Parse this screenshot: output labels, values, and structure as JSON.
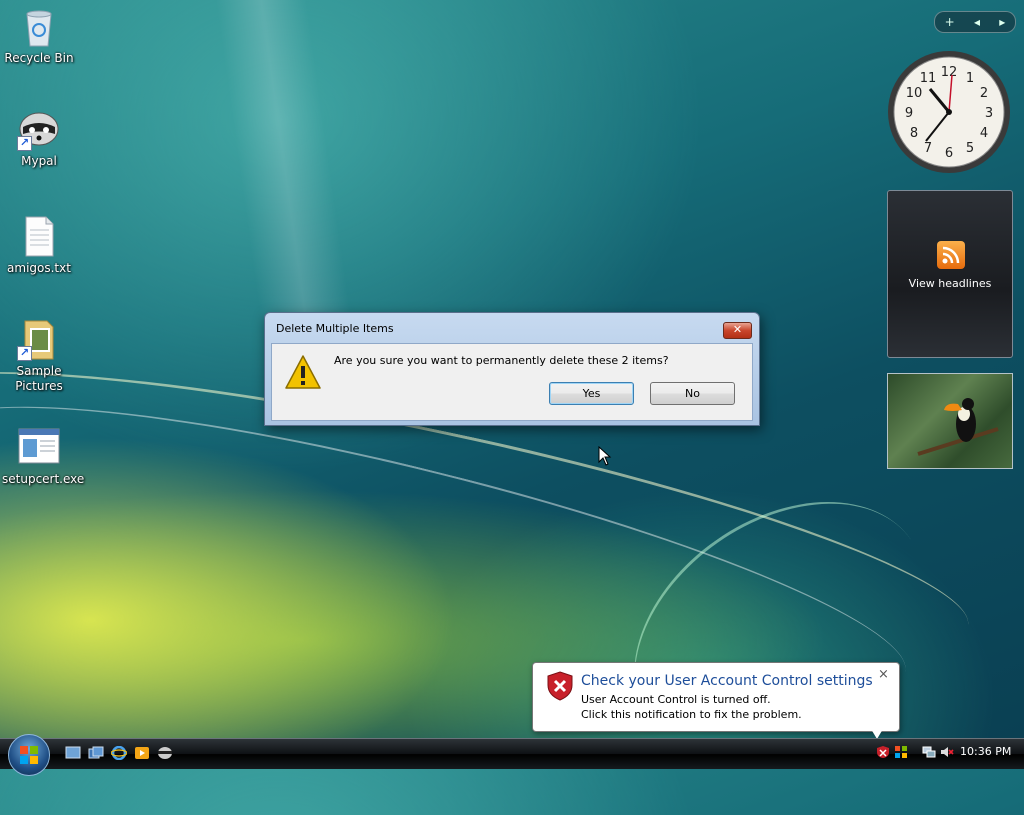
{
  "desktop": {
    "icons": [
      {
        "label": "Recycle Bin",
        "icon": "recycle-bin-icon"
      },
      {
        "label": "Mypal",
        "icon": "mypal-icon"
      },
      {
        "label": "amigos.txt",
        "icon": "text-file-icon"
      },
      {
        "label": "Sample Pictures",
        "icon": "folder-icon"
      },
      {
        "label": "setupcert.exe",
        "icon": "exe-icon"
      }
    ]
  },
  "gadgets": {
    "toolbar_add": "+",
    "toolbar_prev": "◂",
    "toolbar_next": "▸",
    "clock_numbers": [
      "12",
      "1",
      "2",
      "3",
      "4",
      "5",
      "6",
      "7",
      "8",
      "9",
      "10",
      "11"
    ],
    "news_label": "View headlines"
  },
  "dialog": {
    "title": "Delete Multiple Items",
    "close_glyph": "✕",
    "message": "Are you sure you want to permanently delete these 2 items?",
    "yes_label": "Yes",
    "no_label": "No"
  },
  "notification": {
    "title": "Check your User Account Control settings",
    "line1": "User Account Control is turned off.",
    "line2": "Click this notification to fix the problem.",
    "close_glyph": "×"
  },
  "taskbar": {
    "clock": "10:36 PM"
  },
  "colors": {
    "balloon_title": "#1e4e9a",
    "warning": "#f2c200",
    "uac_shield": "#c8202a"
  }
}
